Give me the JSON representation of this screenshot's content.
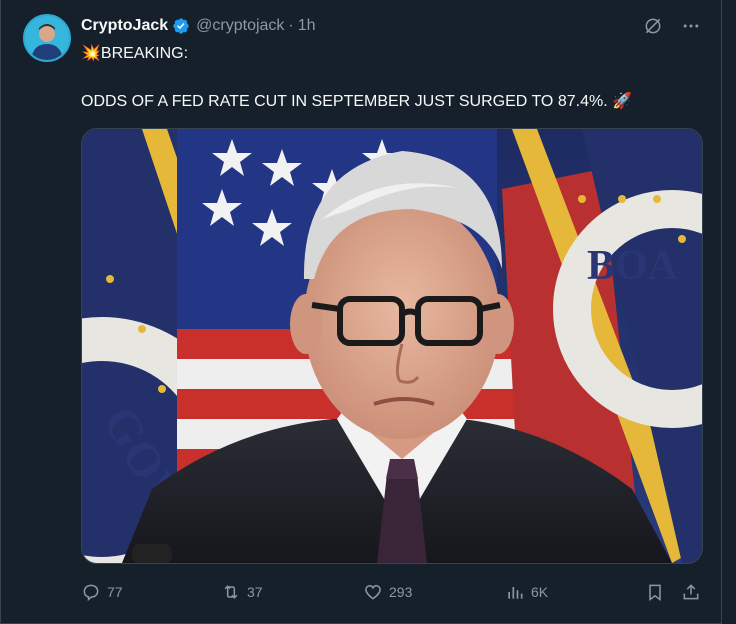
{
  "tweet": {
    "author_name": "CryptoJack",
    "handle": "@cryptojack",
    "separator": "·",
    "time": "1h",
    "line1_emoji": "💥",
    "line1_text": "BREAKING:",
    "line2_text": "ODDS OF A FED RATE CUT IN SEPTEMBER JUST SURGED TO 87.4%.",
    "line2_emoji": "🚀",
    "media_seal_text": "GOV",
    "media_seal_text2": "BOA"
  },
  "actions": {
    "replies": "77",
    "reposts": "37",
    "likes": "293",
    "views": "6K"
  },
  "colors": {
    "background": "#15202b",
    "border": "#38444d",
    "muted": "#8b98a5",
    "verified": "#1d9bf0"
  }
}
